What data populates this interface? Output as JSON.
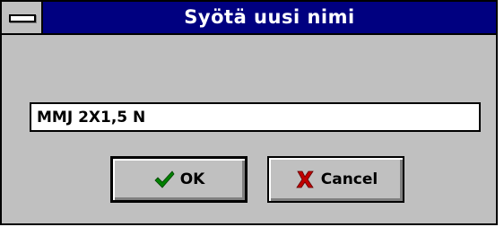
{
  "dialog": {
    "title": "Syötä uusi nimi",
    "input": {
      "value": "MMJ 2X1,5 N"
    },
    "buttons": {
      "ok": {
        "label": "OK",
        "icon": "checkmark-icon",
        "icon_color": "#008000"
      },
      "cancel": {
        "label": "Cancel",
        "icon": "x-icon",
        "icon_color": "#c00000"
      }
    }
  },
  "colors": {
    "titlebar": "#000080",
    "face": "#c0c0c0"
  }
}
